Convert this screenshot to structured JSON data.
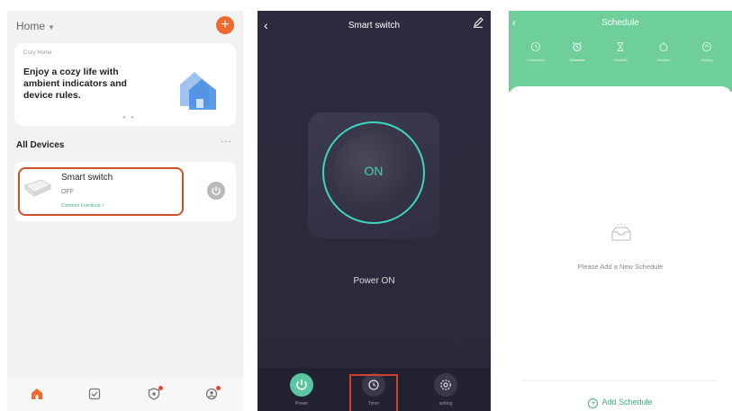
{
  "home": {
    "title": "Home",
    "banner": {
      "subtitle": "Cozy Home",
      "text": "Enjoy a cozy life with ambient indicators and device rules."
    },
    "section_title": "All Devices",
    "more_label": "···",
    "device": {
      "name": "Smart switch",
      "status": "OFF",
      "room": "Common Functions >"
    }
  },
  "switch_page": {
    "title": "Smart switch",
    "button_label": "ON",
    "status_label": "Power ON",
    "bottom": [
      {
        "label": "Power"
      },
      {
        "label": "Timer"
      },
      {
        "label": "setting"
      }
    ]
  },
  "schedule_page": {
    "title": "Schedule",
    "tabs": [
      {
        "label": "Countdown"
      },
      {
        "label": "Schedule"
      },
      {
        "label": "Circulate"
      },
      {
        "label": "Random"
      },
      {
        "label": "Inching"
      }
    ],
    "empty_text": "Please Add a New Schedule",
    "add_label": "Add Schedule"
  },
  "colors": {
    "accent_orange": "#ef6a2d",
    "highlight_red": "#d0502e",
    "teal": "#3fd3c0",
    "green": "#6fcf9b",
    "dark_bg": "#2c2a3c"
  }
}
